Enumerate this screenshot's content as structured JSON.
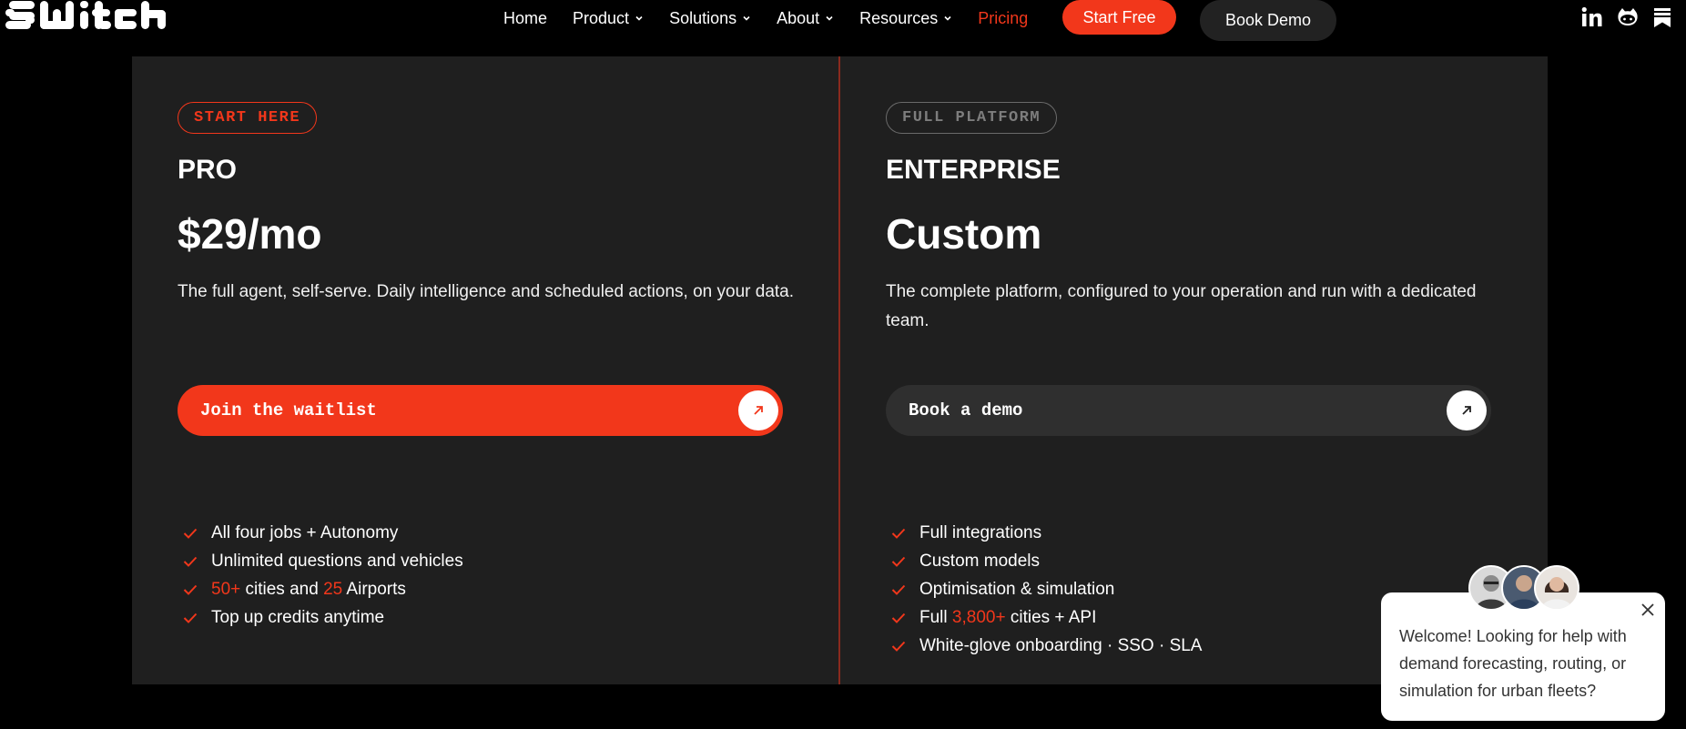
{
  "nav": {
    "logo_text": "SWITCH",
    "links": [
      {
        "label": "Home"
      },
      {
        "label": "Product"
      },
      {
        "label": "Solutions"
      },
      {
        "label": "About"
      },
      {
        "label": "Resources"
      },
      {
        "label": "Pricing"
      }
    ],
    "start_free_label": "Start Free",
    "book_demo_label": "Book Demo",
    "social_icons": [
      "linkedin-icon",
      "github-icon",
      "bookmark-icon"
    ],
    "accent_color": "#f2371b"
  },
  "plans": {
    "pro": {
      "badge": "START HERE",
      "name": "PRO",
      "price": "$29/mo",
      "description": "The full agent, self-serve. Daily intelligence and scheduled actions, on your data.",
      "cta_label": "Join the waitlist",
      "features": [
        {
          "parts": [
            {
              "text": "All four jobs + Autonomy"
            }
          ]
        },
        {
          "parts": [
            {
              "text": "Unlimited questions and vehicles"
            }
          ]
        },
        {
          "parts": [
            {
              "text": "50+",
              "highlight": true
            },
            {
              "text": " cities and "
            },
            {
              "text": "25",
              "highlight": true
            },
            {
              "text": " Airports"
            }
          ]
        },
        {
          "parts": [
            {
              "text": "Top up credits anytime"
            }
          ]
        }
      ]
    },
    "enterprise": {
      "badge": "FULL PLATFORM",
      "name": "ENTERPRISE",
      "price": "Custom",
      "description": "The complete platform, configured to your operation and run with a dedicated team.",
      "cta_label": "Book a demo",
      "features": [
        {
          "parts": [
            {
              "text": "Full integrations"
            }
          ]
        },
        {
          "parts": [
            {
              "text": "Custom models"
            }
          ]
        },
        {
          "parts": [
            {
              "text": "Optimisation & simulation"
            }
          ]
        },
        {
          "parts": [
            {
              "text": "Full "
            },
            {
              "text": "3,800+",
              "highlight": true
            },
            {
              "text": " cities + API"
            }
          ]
        },
        {
          "parts": [
            {
              "text": "White-glove onboarding · SSO · SLA"
            }
          ]
        }
      ]
    }
  },
  "chat": {
    "message": "Welcome! Looking for help with demand forecasting, routing, or simulation for urban fleets?"
  }
}
